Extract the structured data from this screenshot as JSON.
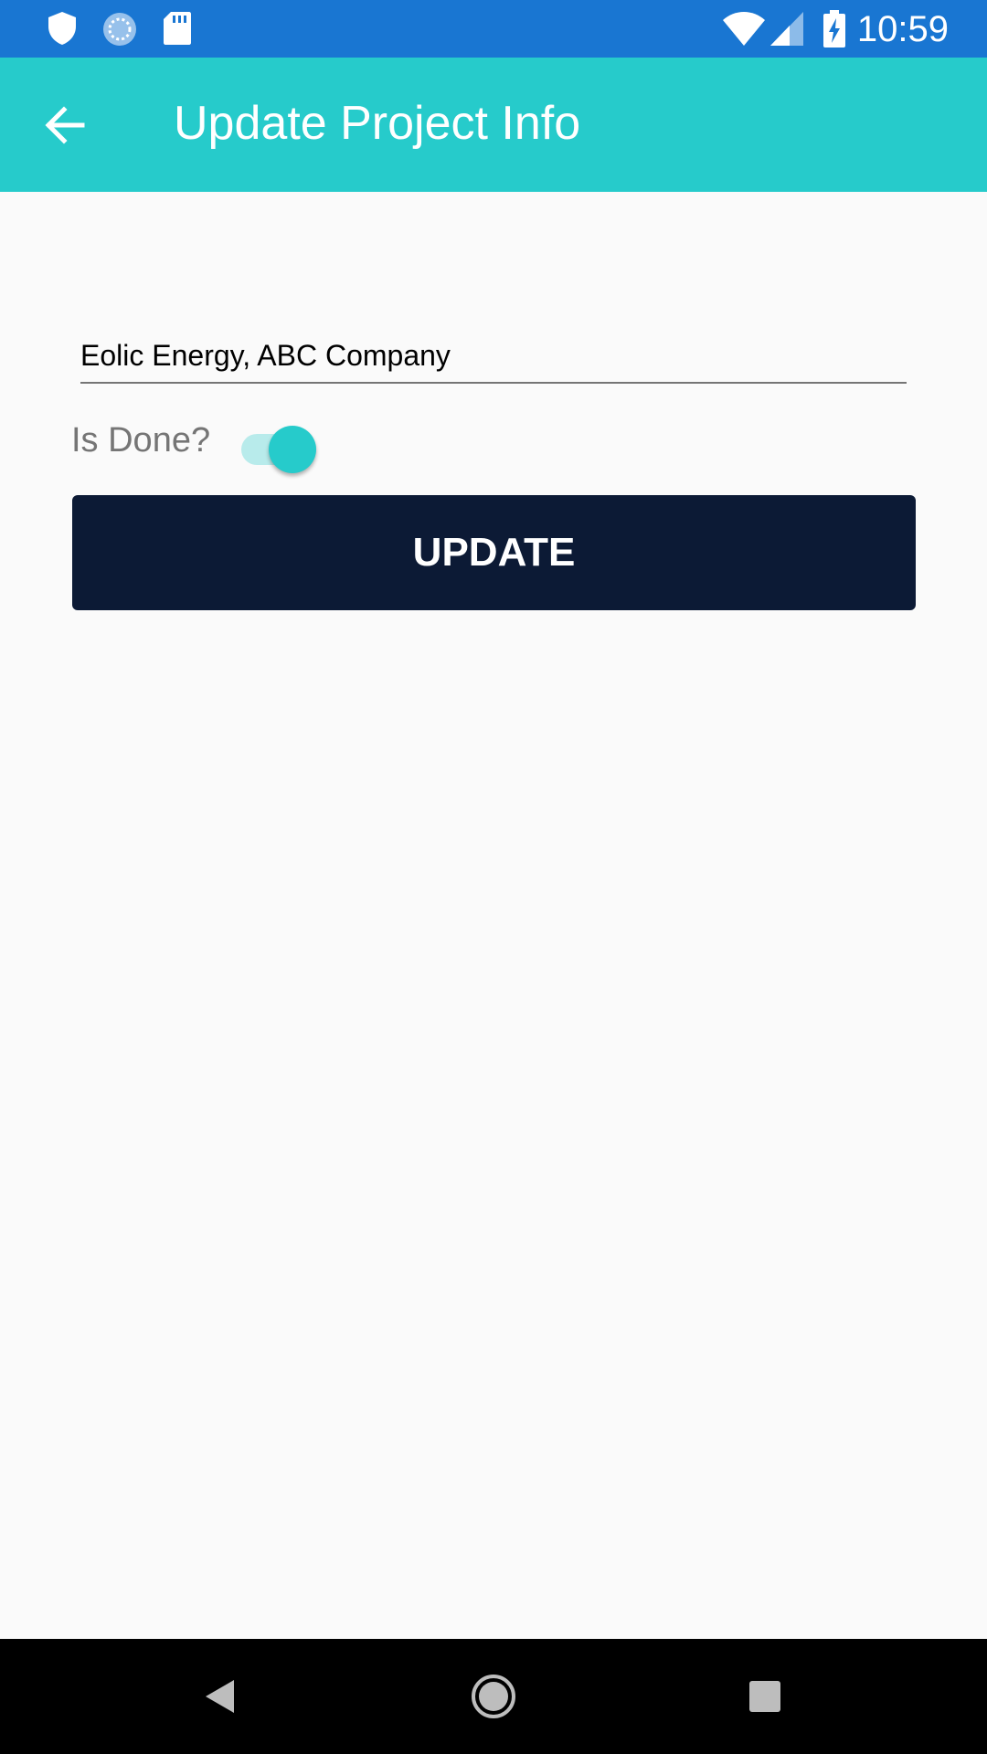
{
  "status_bar": {
    "time": "10:59",
    "icons": [
      "shield-icon",
      "sync-icon",
      "sd-card-icon",
      "wifi-icon",
      "signal-icon",
      "battery-charging-icon"
    ],
    "color": "#1976d2"
  },
  "app_bar": {
    "title": "Update Project Info",
    "back_icon": "arrow-back-icon",
    "color": "#26cbcb"
  },
  "form": {
    "name_value": "Eolic Energy, ABC Company",
    "is_done_label": "Is Done?",
    "is_done_checked": true,
    "update_label": "UPDATE",
    "button_color": "#0c1a35"
  },
  "nav_bar": {
    "icons": [
      "back-triangle-icon",
      "home-circle-icon",
      "recents-square-icon"
    ]
  }
}
